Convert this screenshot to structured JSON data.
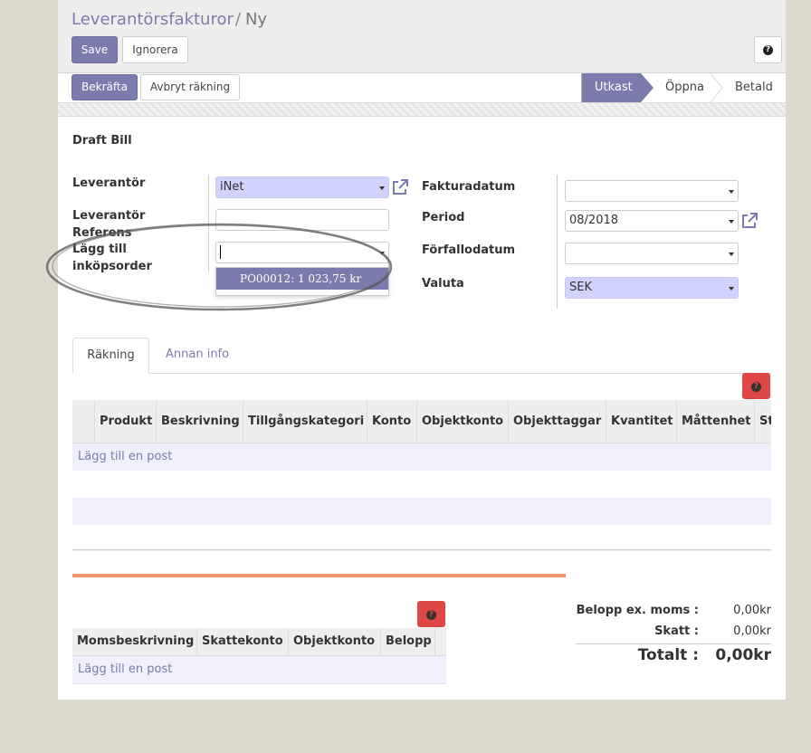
{
  "breadcrumb": {
    "parent": "Leverantörsfakturor",
    "separator": "/",
    "current": "Ny"
  },
  "buttons": {
    "save": "Save",
    "discard": "Ignorera",
    "help": "?",
    "confirm": "Bekräfta",
    "cancel_bill": "Avbryt räkning"
  },
  "statusbar": {
    "stages": [
      "Utkast",
      "Öppna",
      "Betald"
    ],
    "active": "Utkast"
  },
  "form": {
    "title": "Draft Bill",
    "vendor": {
      "label": "Leverantör",
      "value": "iNet"
    },
    "vendor_reference": {
      "label_line1": "Leverantör",
      "label_line2": "Referens",
      "value": ""
    },
    "add_po": {
      "label_line1": "Lägg till",
      "label_line2": "inköpsorder",
      "value": "",
      "dropdown_option": "PO00012: 1 023,75 kr"
    },
    "invoice_date": {
      "label": "Fakturadatum",
      "value": ""
    },
    "period": {
      "label": "Period",
      "value": "08/2018"
    },
    "due_date": {
      "label": "Förfallodatum",
      "value": ""
    },
    "currency": {
      "label": "Valuta",
      "value": "SEK"
    }
  },
  "tabs": [
    {
      "label": "Räkning",
      "active": true
    },
    {
      "label": "Annan info",
      "active": false
    }
  ],
  "lines_table": {
    "columns": [
      "Produkt",
      "Beskrivning",
      "Tillgångskategori",
      "Konto",
      "Objektkonto",
      "Objekttaggar",
      "Kvantitet",
      "Måttenhet",
      "St"
    ],
    "add_line": "Lägg till en post"
  },
  "tax_table": {
    "columns": [
      "Momsbeskrivning",
      "Skattekonto",
      "Objektkonto",
      "Belopp"
    ],
    "add_line": "Lägg till en post"
  },
  "totals": {
    "untaxed_label": "Belopp ex. moms :",
    "untaxed_value": "0,00kr",
    "tax_label": "Skatt :",
    "tax_value": "0,00kr",
    "total_label": "Totalt :",
    "total_value": "0,00kr"
  },
  "colors": {
    "primary": "#7c7bad",
    "required_field": "#d2d2ff",
    "danger": "#e04747",
    "accent_bar": "#f0956c"
  }
}
